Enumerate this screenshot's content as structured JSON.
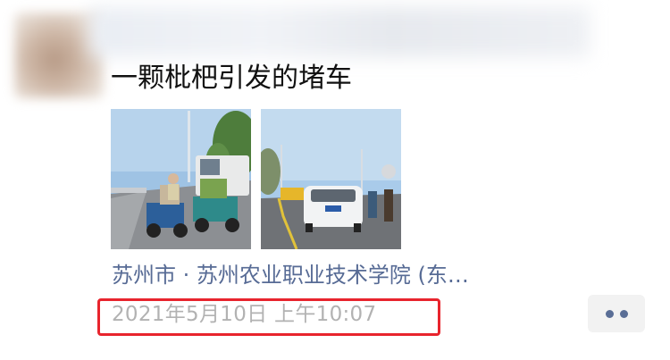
{
  "post": {
    "text": "一颗枇杷引发的堵车",
    "location": "苏州市 · 苏州农业职业技术学院 (东…",
    "timestamp": "2021年5月10日 上午10:07",
    "photos": [
      {
        "name": "photo-traffic-tricycles",
        "icon": "photo"
      },
      {
        "name": "photo-traffic-white-car",
        "icon": "photo"
      }
    ]
  },
  "colors": {
    "link": "#576b95",
    "timestamp": "#b2b2b2",
    "highlight": "#e8242d",
    "more_dots": "#5a6e96"
  },
  "icons": {
    "more": "more-dots-icon"
  }
}
